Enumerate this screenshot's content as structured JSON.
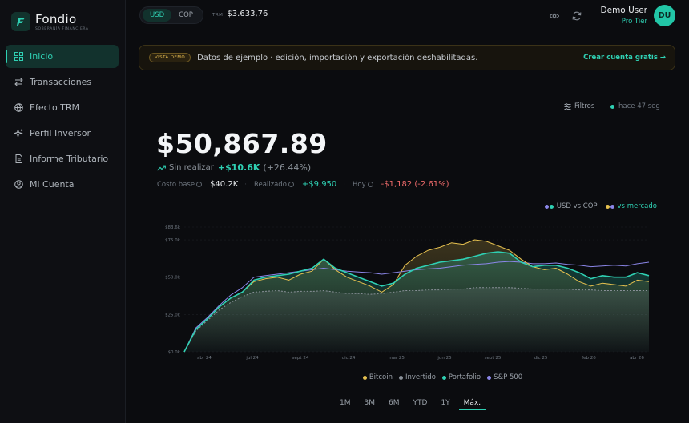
{
  "brand": {
    "name": "Fondio",
    "tagline": "SOBERANÍA FINANCIERA"
  },
  "nav": [
    {
      "label": "Inicio",
      "icon": "grid-icon",
      "active": true
    },
    {
      "label": "Transacciones",
      "icon": "arrows-icon"
    },
    {
      "label": "Efecto TRM",
      "icon": "globe-icon"
    },
    {
      "label": "Perfil Inversor",
      "icon": "sparkle-icon"
    },
    {
      "label": "Informe Tributario",
      "icon": "document-icon"
    },
    {
      "label": "Mi Cuenta",
      "icon": "user-circle-icon"
    }
  ],
  "topbar": {
    "currencies": [
      "USD",
      "COP"
    ],
    "selected_currency": "USD",
    "trm_label": "TRM",
    "trm_value": "$3.633,76",
    "user_name": "Demo User",
    "user_tier": "Pro Tier",
    "avatar_initials": "DU"
  },
  "banner": {
    "badge": "VISTA DEMO",
    "text": "Datos de ejemplo · edición, importación y exportación deshabilitadas.",
    "link": "Crear cuenta gratis →"
  },
  "summary": {
    "filters_label": "Filtros",
    "updated_label": "hace 47 seg",
    "total_value": "$50,867.89",
    "unrealized_label": "Sin realizar",
    "unrealized_value": "+$10.6K",
    "unrealized_pct": "(+26.44%)",
    "cost_label": "Costo base",
    "cost_value": "$40.2K",
    "realized_label": "Realizado",
    "realized_value": "+$9,950",
    "today_label": "Hoy",
    "today_value": "-$1,182 (-2.61%)"
  },
  "chart_toggles": {
    "usd_vs_cop": "USD vs COP",
    "vs_market": "vs mercado"
  },
  "colors": {
    "accent": "#2fd0b3",
    "bitcoin": "#e6c14f",
    "invested": "#8a9199",
    "portfolio": "#2fd0b3",
    "sp500": "#8b86e8",
    "negative": "#f06b6b"
  },
  "chart_data": {
    "type": "line",
    "y_ticks": [
      "$0.0k",
      "$25.0k",
      "$50.0k",
      "$75.0k",
      "$83.6k"
    ],
    "ylim": [
      0,
      83600
    ],
    "x_ticks": [
      "abr 24",
      "jul 24",
      "sept 24",
      "dic 24",
      "mar 25",
      "jun 25",
      "sept 25",
      "dic 25",
      "feb 26",
      "abr 26"
    ],
    "x": [
      0,
      1,
      2,
      3,
      4,
      5,
      6,
      7,
      8,
      9,
      10,
      11,
      12,
      13,
      14,
      15,
      16,
      17,
      18,
      19,
      20,
      21,
      22,
      23,
      24,
      25,
      26,
      27,
      28,
      29,
      30,
      31,
      32,
      33,
      34,
      35,
      36,
      37,
      38,
      39,
      40
    ],
    "series": [
      {
        "name": "Bitcoin",
        "color": "#e6c14f",
        "values": [
          0,
          15000,
          22000,
          30000,
          36000,
          40000,
          47000,
          49000,
          50000,
          48000,
          52000,
          54000,
          62000,
          55000,
          50000,
          47000,
          44000,
          40000,
          45000,
          58000,
          64000,
          68000,
          70000,
          73000,
          72000,
          75000,
          74000,
          71000,
          68000,
          62000,
          57000,
          55000,
          56000,
          52000,
          47000,
          44000,
          46000,
          45000,
          44000,
          48000,
          47000
        ]
      },
      {
        "name": "Invertido",
        "color": "#8a9199",
        "values": [
          0,
          14000,
          21000,
          28000,
          33000,
          37000,
          40000,
          40500,
          41000,
          40000,
          40500,
          40500,
          41000,
          40000,
          39000,
          39000,
          38500,
          39000,
          40000,
          41000,
          41000,
          41500,
          41500,
          42000,
          42000,
          43000,
          43000,
          43000,
          43000,
          42500,
          42000,
          42000,
          42000,
          42000,
          41500,
          41500,
          41000,
          41000,
          41000,
          41000,
          41000
        ]
      },
      {
        "name": "Portafolio",
        "color": "#2fd0b3",
        "values": [
          0,
          15000,
          22000,
          30000,
          36000,
          40000,
          48000,
          50000,
          51000,
          52000,
          54000,
          56000,
          62000,
          56000,
          53000,
          50000,
          47000,
          44000,
          46000,
          52000,
          56000,
          58000,
          60000,
          61000,
          62000,
          64000,
          66000,
          67000,
          66000,
          60000,
          57000,
          58000,
          58000,
          56000,
          53000,
          49000,
          51000,
          50000,
          50000,
          53000,
          51000
        ]
      },
      {
        "name": "S&P 500",
        "color": "#8b86e8",
        "values": [
          0,
          16000,
          23000,
          31000,
          38000,
          43000,
          50000,
          51000,
          52000,
          53000,
          54000,
          55000,
          56000,
          55000,
          54000,
          53500,
          53000,
          52000,
          53000,
          54000,
          55000,
          55500,
          56000,
          57000,
          58000,
          58500,
          59000,
          60000,
          60500,
          60000,
          59000,
          59000,
          59500,
          58500,
          58000,
          57000,
          57500,
          58000,
          57500,
          59000,
          60000
        ]
      }
    ]
  },
  "ranges": [
    "1M",
    "3M",
    "6M",
    "YTD",
    "1Y",
    "Máx."
  ],
  "selected_range": "Máx."
}
